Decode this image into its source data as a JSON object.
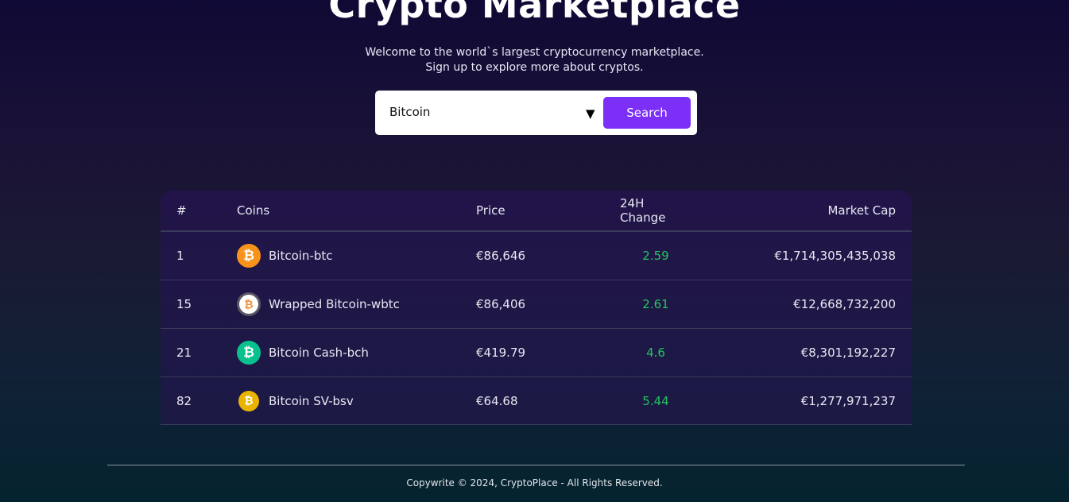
{
  "hero": {
    "title": "Crypto Marketplace",
    "subtitle_line1": "Welcome to the world`s largest cryptocurrency marketplace.",
    "subtitle_line2": "Sign up to explore more about cryptos."
  },
  "search": {
    "value": "Bitcoin",
    "button_label": "Search"
  },
  "table": {
    "headers": {
      "rank": "#",
      "coins": "Coins",
      "price": "Price",
      "change": "24H Change",
      "market_cap": "Market Cap"
    },
    "rows": [
      {
        "rank": "1",
        "coin": "Bitcoin-btc",
        "price": "€86,646",
        "change": "2.59",
        "market_cap": "€1,714,305,435,038",
        "icon": "bitcoin-icon",
        "icon_color": "#f7931a"
      },
      {
        "rank": "15",
        "coin": "Wrapped Bitcoin-wbtc",
        "price": "€86,406",
        "change": "2.61",
        "market_cap": "€12,668,732,200",
        "icon": "wrapped-bitcoin-icon",
        "icon_color": "#f09242"
      },
      {
        "rank": "21",
        "coin": "Bitcoin Cash-bch",
        "price": "€419.79",
        "change": "4.6",
        "market_cap": "€8,301,192,227",
        "icon": "bitcoin-cash-icon",
        "icon_color": "#0ac18e"
      },
      {
        "rank": "82",
        "coin": "Bitcoin SV-bsv",
        "price": "€64.68",
        "change": "5.44",
        "market_cap": "€1,277,971,237",
        "icon": "bitcoin-sv-icon",
        "icon_color": "#eab300"
      }
    ]
  },
  "footer": {
    "text": "Copywrite © 2024, CryptoPlace - All Rights Reserved."
  },
  "colors": {
    "accent": "#7b2ff7",
    "positive_change": "#22c55e"
  }
}
